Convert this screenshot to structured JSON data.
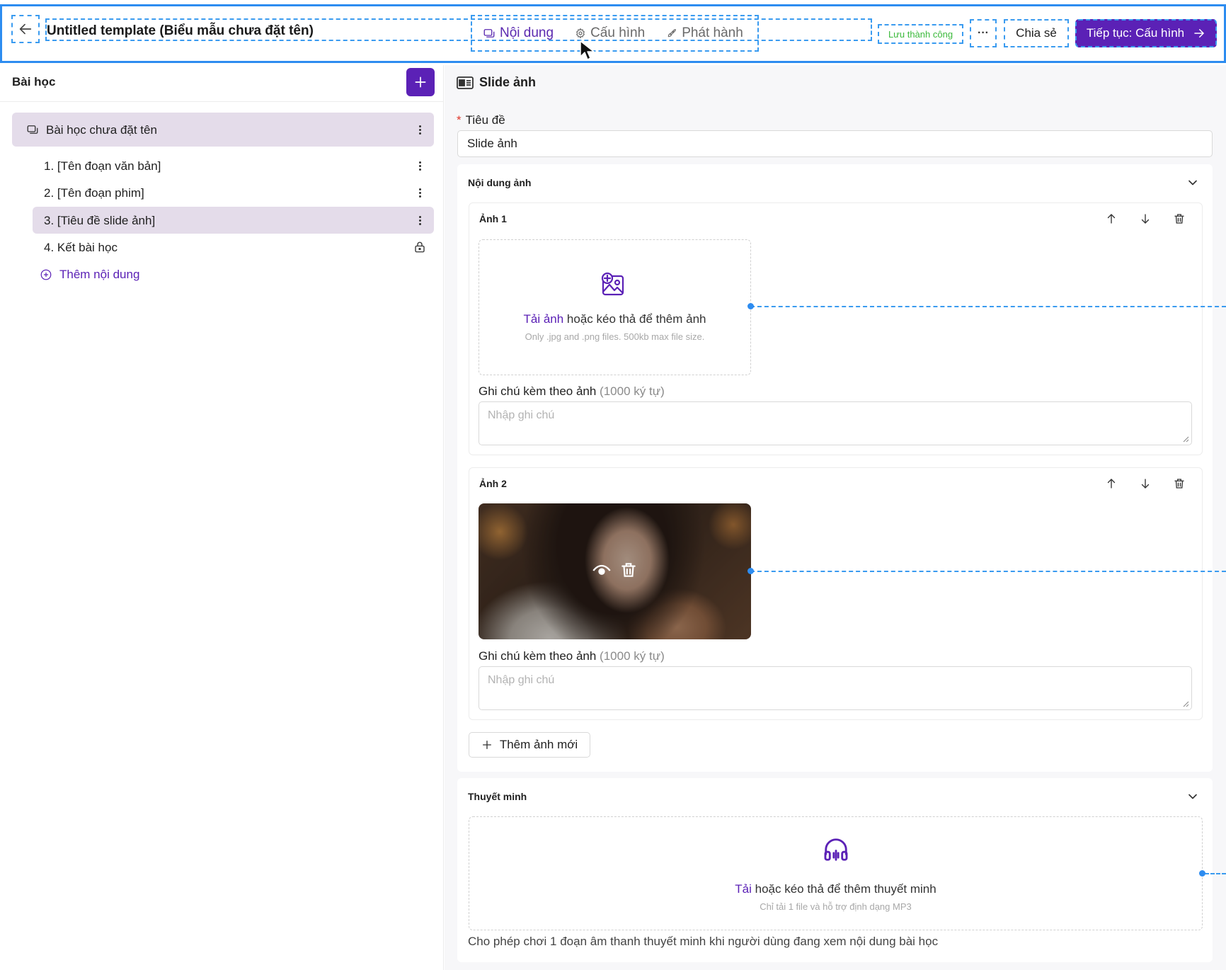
{
  "topbar": {
    "title": "Untitled template (Biểu mẫu chưa đặt tên)",
    "tabs": [
      {
        "label": "Nội dung",
        "icon": "slides-icon",
        "active": true
      },
      {
        "label": "Cấu hình",
        "icon": "gear-icon",
        "active": false
      },
      {
        "label": "Phát hành",
        "icon": "rocket-icon",
        "active": false
      }
    ],
    "save_status": "Lưu thành công",
    "more_label": "···",
    "share_label": "Chia sẻ",
    "continue_label": "Tiếp tục: Cấu hình"
  },
  "sidebar": {
    "title": "Bài học",
    "lesson": {
      "label": "Bài học chưa đặt tên"
    },
    "items": [
      {
        "label": "1. [Tên đoạn văn bản]",
        "selected": false,
        "action": "kebab"
      },
      {
        "label": "2. [Tên đoạn phim]",
        "selected": false,
        "action": "kebab"
      },
      {
        "label": "3. [Tiêu đề slide ảnh]",
        "selected": true,
        "action": "kebab"
      },
      {
        "label": "4. Kết bài học",
        "selected": false,
        "action": "lock"
      }
    ],
    "add_content": "Thêm nội dung"
  },
  "main": {
    "heading": "Slide ảnh",
    "title_field": {
      "label": "Tiêu đề",
      "required_mark": "*",
      "value": "Slide ảnh"
    },
    "image_section": {
      "title": "Nội dung ảnh",
      "images": [
        {
          "title": "Ảnh 1",
          "upload_link": "Tải ảnh",
          "upload_text": " hoặc kéo thả để thêm ảnh",
          "upload_hint": "Only .jpg and .png files. 500kb max file size.",
          "note_label": "Ghi chú kèm theo ảnh",
          "note_limit": " (1000 ký tự)",
          "note_placeholder": "Nhập ghi chú"
        },
        {
          "title": "Ảnh 2",
          "note_label": "Ghi chú kèm theo ảnh",
          "note_limit": " (1000 ký tự)",
          "note_placeholder": "Nhập ghi chú"
        }
      ],
      "add_image": "Thêm ảnh mới"
    },
    "narration_section": {
      "title": "Thuyết minh",
      "upload_link": "Tải",
      "upload_text": " hoặc kéo thả để thêm thuyết minh",
      "upload_hint": "Chỉ tải 1 file và hỗ trợ định dạng MP3",
      "description": "Cho phép chơi 1 đoạn âm thanh thuyết minh khi người dùng đang xem nội dung bài học"
    }
  },
  "colors": {
    "accent": "#5b21b6",
    "selection_bg": "#e4dcea",
    "success": "#3cba3c",
    "annotation_blue": "#2d8cf0"
  }
}
